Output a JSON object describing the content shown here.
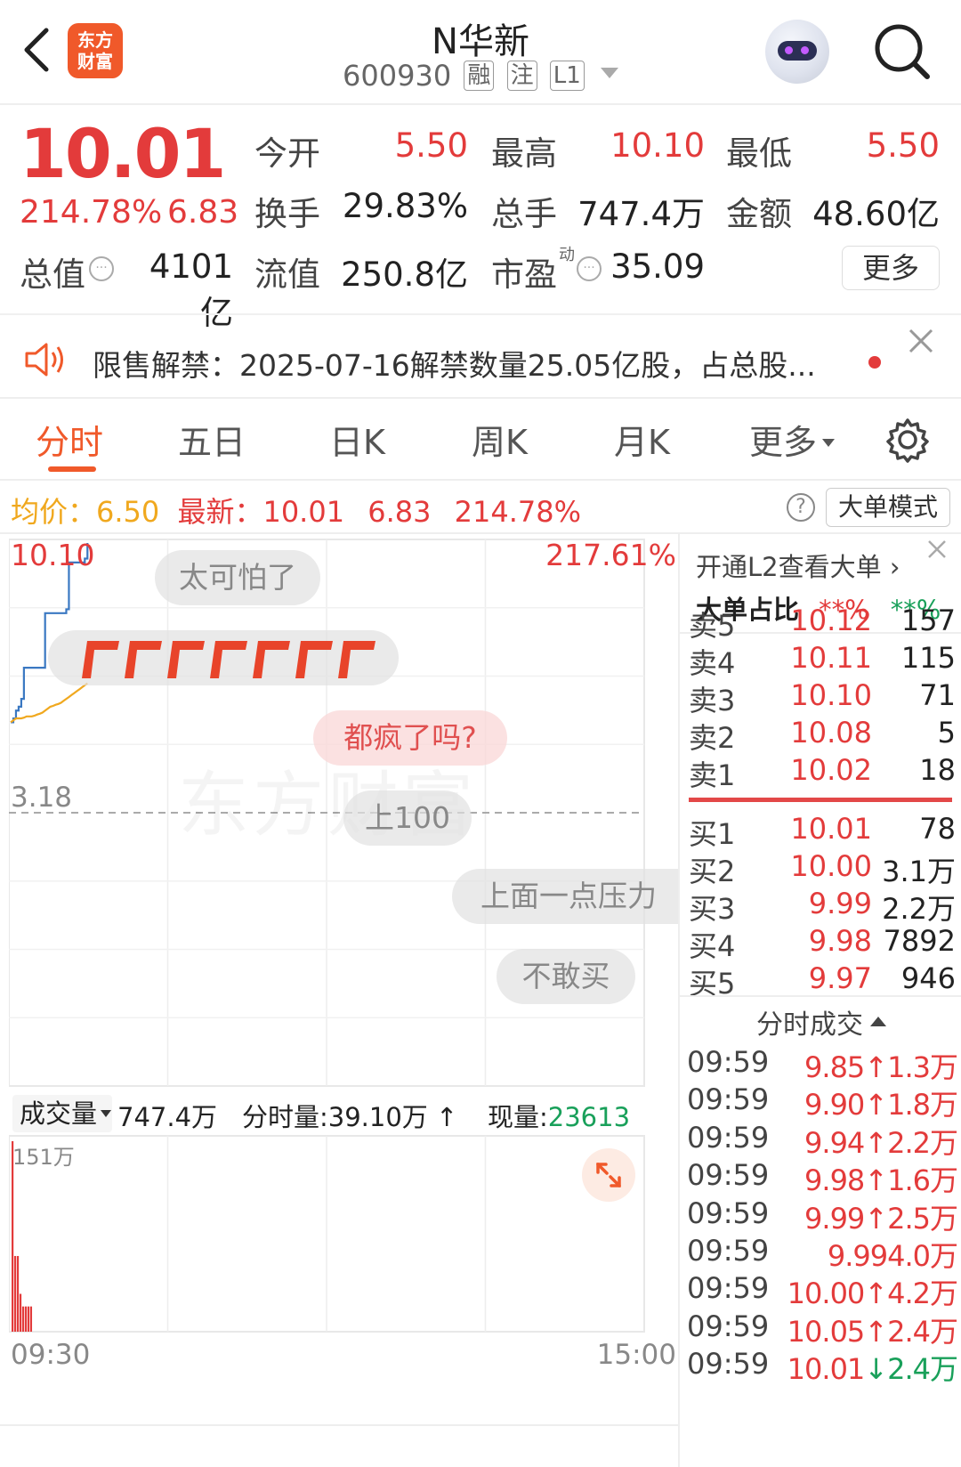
{
  "header": {
    "back_icon": "chevron-left-icon",
    "logo_lines": [
      "东方",
      "财富"
    ],
    "title": "N华新",
    "code": "600930",
    "tags": [
      "融",
      "注",
      "L1"
    ],
    "robot_icon": "robot-avatar-icon",
    "search_icon": "search-icon"
  },
  "quote": {
    "price": "10.01",
    "change_pct": "214.78%",
    "change": "6.83",
    "open_label": "今开",
    "open": "5.50",
    "high_label": "最高",
    "high": "10.10",
    "low_label": "最低",
    "low": "5.50",
    "turnover_label": "换手",
    "turnover": "29.83%",
    "volume_label": "总手",
    "volume": "747.4万",
    "amount_label": "金额",
    "amount": "48.60亿",
    "mktcap_label": "总值",
    "mktcap": "4101亿",
    "float_label": "流值",
    "float_cap": "250.8亿",
    "pe_label": "市盈",
    "pe_sup": "动",
    "pe": "35.09",
    "more": "更多"
  },
  "notice": {
    "text": "限售解禁：2025-07-16解禁数量25.05亿股，占总股..."
  },
  "tabs": [
    "分时",
    "五日",
    "日K",
    "周K",
    "月K",
    "更多"
  ],
  "active_tab": "分时",
  "info_row": {
    "avg_label": "均价：",
    "avg": "6.50",
    "latest_label": "最新：",
    "latest": "10.01",
    "change": "6.83",
    "pct": "214.78%",
    "mode_button": "大单模式"
  },
  "chart": {
    "high_price": "10.10",
    "high_pct": "217.61%",
    "ref_label": "3.18",
    "watermark": "东方财富",
    "danmu": [
      "太可怕了",
      "都疯了吗?",
      "上100",
      "上面一点压力",
      "不敢买"
    ],
    "volume_selector": "成交量",
    "volume_total": "747.4万",
    "minute_vol_label": "分时量:",
    "minute_vol": "39.10万",
    "current_vol_label": "现量:",
    "current_vol": "23613",
    "vol_axis_max": "151万",
    "time_start": "09:30",
    "time_end": "15:00",
    "expand_icon": "expand-arrows-icon"
  },
  "chart_data": {
    "type": "line",
    "x": [
      "09:30",
      "09:31",
      "09:32",
      "09:33",
      "09:34",
      "09:35",
      "09:36",
      "09:37",
      "09:38",
      "09:39",
      "09:40",
      "09:41",
      "09:42",
      "09:43",
      "09:44",
      "09:45",
      "09:46",
      "09:47",
      "09:48",
      "09:49",
      "09:50",
      "09:51",
      "09:52",
      "09:53",
      "09:54",
      "09:55",
      "09:56",
      "09:57",
      "09:58",
      "09:59"
    ],
    "series": [
      {
        "values": [
          5.5,
          5.6,
          5.8,
          5.9,
          6.1,
          6.9,
          6.9,
          6.9,
          6.9,
          6.9,
          6.9,
          6.9,
          6.9,
          8.3,
          8.3,
          8.3,
          8.3,
          8.3,
          8.3,
          8.3,
          8.3,
          8.4,
          9.6,
          9.6,
          9.6,
          9.6,
          9.6,
          9.6,
          9.7,
          10.1
        ]
      },
      {
        "values": [
          5.5,
          5.55,
          5.6,
          5.6,
          5.6,
          5.62,
          5.65,
          5.65,
          5.65,
          5.67,
          5.7,
          5.72,
          5.75,
          5.8,
          5.85,
          5.9,
          5.92,
          5.95,
          5.97,
          6.0,
          6.05,
          6.1,
          6.15,
          6.2,
          6.25,
          6.3,
          6.35,
          6.4,
          6.45,
          6.5
        ]
      }
    ],
    "volume": [
      151,
      60,
      60,
      30,
      20,
      20,
      20,
      20,
      0,
      0,
      0,
      0,
      0,
      0,
      0,
      0,
      0,
      0,
      0,
      0,
      0,
      0,
      0,
      0,
      0,
      0,
      0,
      0,
      0,
      0
    ],
    "volume_unit": "万",
    "ylim": [
      3.18,
      10.1
    ],
    "xlim": [
      "09:30",
      "15:00"
    ]
  },
  "order_book": {
    "l2_link": "开通L2查看大单",
    "ratio_label": "大单占比",
    "ratio_red": "**%",
    "ratio_green": "**%",
    "asks": [
      {
        "label": "卖5",
        "price": "10.12",
        "vol": "157"
      },
      {
        "label": "卖4",
        "price": "10.11",
        "vol": "115"
      },
      {
        "label": "卖3",
        "price": "10.10",
        "vol": "71"
      },
      {
        "label": "卖2",
        "price": "10.08",
        "vol": "5"
      },
      {
        "label": "卖1",
        "price": "10.02",
        "vol": "18"
      }
    ],
    "bids": [
      {
        "label": "买1",
        "price": "10.01",
        "vol": "78"
      },
      {
        "label": "买2",
        "price": "10.00",
        "vol": "3.1万"
      },
      {
        "label": "买3",
        "price": "9.99",
        "vol": "2.2万"
      },
      {
        "label": "买4",
        "price": "9.98",
        "vol": "7892"
      },
      {
        "label": "买5",
        "price": "9.97",
        "vol": "946"
      }
    ],
    "trades_header": "分时成交",
    "trades": [
      {
        "time": "09:59",
        "price": "9.85",
        "dir": "↑",
        "vol": "1.3万"
      },
      {
        "time": "09:59",
        "price": "9.90",
        "dir": "↑",
        "vol": "1.8万"
      },
      {
        "time": "09:59",
        "price": "9.94",
        "dir": "↑",
        "vol": "2.2万"
      },
      {
        "time": "09:59",
        "price": "9.98",
        "dir": "↑",
        "vol": "1.6万"
      },
      {
        "time": "09:59",
        "price": "9.99",
        "dir": "↑",
        "vol": "2.5万"
      },
      {
        "time": "09:59",
        "price": "9.99",
        "dir": "",
        "vol": "4.0万"
      },
      {
        "time": "09:59",
        "price": "10.00",
        "dir": "↑",
        "vol": "4.2万"
      },
      {
        "time": "09:59",
        "price": "10.05",
        "dir": "↑",
        "vol": "2.4万"
      },
      {
        "time": "09:59",
        "price": "10.01",
        "dir": "↓",
        "vol": "2.4万"
      }
    ]
  },
  "colors": {
    "up": "#e33b3b",
    "down": "#19a05a",
    "accent": "#f0592a",
    "price_line": "#3a78c2",
    "avg_line": "#f0a81e"
  }
}
